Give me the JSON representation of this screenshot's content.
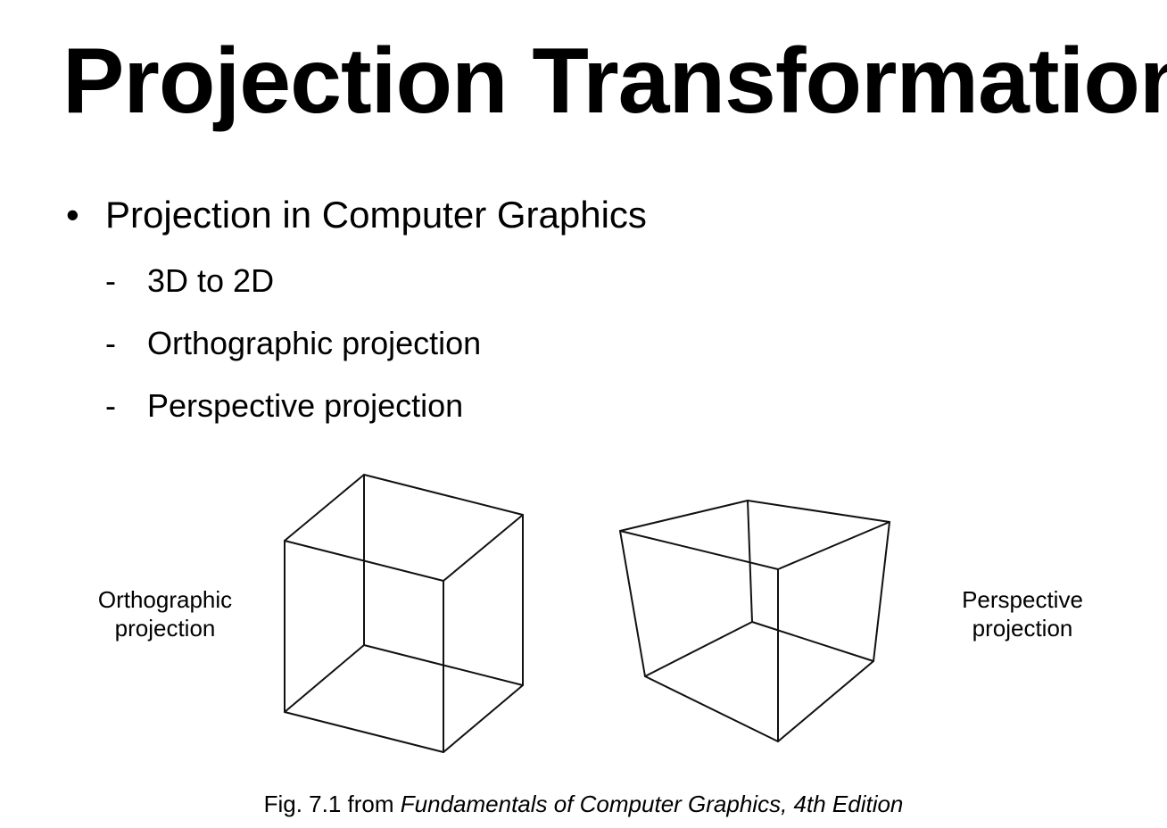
{
  "slide": {
    "title": "Projection Transformation",
    "bullet": {
      "marker": "•",
      "text": "Projection in Computer Graphics"
    },
    "sub_items": [
      {
        "marker": "-",
        "text": "3D to 2D"
      },
      {
        "marker": "-",
        "text": "Orthographic projection"
      },
      {
        "marker": "-",
        "text": "Perspective projection"
      }
    ]
  },
  "figure": {
    "left_label_line1": "Orthographic",
    "left_label_line2": "projection",
    "right_label_line1": "Perspective",
    "right_label_line2": "projection",
    "caption_prefix": "Fig. 7.1 from ",
    "caption_source": "Fundamentals of Computer Graphics, 4th Edition",
    "line_color": "#111111"
  }
}
